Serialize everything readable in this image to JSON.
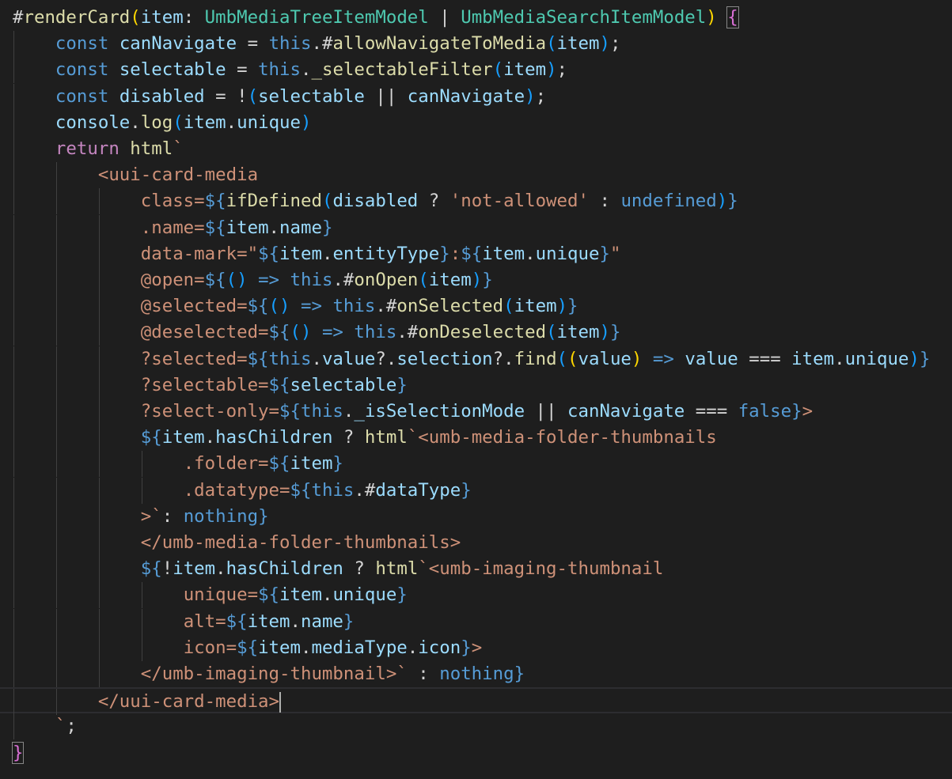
{
  "editor": {
    "cursor_line": 27,
    "lines": [
      {
        "n": 1,
        "indent": 0,
        "tokens": [
          [
            "d",
            "#"
          ],
          [
            "fn",
            "renderCard"
          ],
          [
            "b1",
            "("
          ],
          [
            "var",
            "item"
          ],
          [
            "d",
            ": "
          ],
          [
            "ty",
            "UmbMediaTreeItemModel"
          ],
          [
            "d",
            " | "
          ],
          [
            "ty",
            "UmbMediaSearchItemModel"
          ],
          [
            "b1",
            ")"
          ],
          [
            "d",
            " "
          ],
          [
            "bm2",
            "{"
          ]
        ]
      },
      {
        "n": 2,
        "indent": 1,
        "tokens": [
          [
            "kw",
            "const"
          ],
          [
            "d",
            " "
          ],
          [
            "var",
            "canNavigate"
          ],
          [
            "d",
            " = "
          ],
          [
            "kw",
            "this"
          ],
          [
            "d",
            ".#"
          ],
          [
            "fn",
            "allowNavigateToMedia"
          ],
          [
            "b3",
            "("
          ],
          [
            "var",
            "item"
          ],
          [
            "b3",
            ")"
          ],
          [
            "d",
            ";"
          ]
        ]
      },
      {
        "n": 3,
        "indent": 1,
        "tokens": [
          [
            "kw",
            "const"
          ],
          [
            "d",
            " "
          ],
          [
            "var",
            "selectable"
          ],
          [
            "d",
            " = "
          ],
          [
            "kw",
            "this"
          ],
          [
            "d",
            "."
          ],
          [
            "fn",
            "_selectableFilter"
          ],
          [
            "b3",
            "("
          ],
          [
            "var",
            "item"
          ],
          [
            "b3",
            ")"
          ],
          [
            "d",
            ";"
          ]
        ]
      },
      {
        "n": 4,
        "indent": 1,
        "tokens": [
          [
            "kw",
            "const"
          ],
          [
            "d",
            " "
          ],
          [
            "var",
            "disabled"
          ],
          [
            "d",
            " = !"
          ],
          [
            "b3",
            "("
          ],
          [
            "var",
            "selectable"
          ],
          [
            "d",
            " || "
          ],
          [
            "var",
            "canNavigate"
          ],
          [
            "b3",
            ")"
          ],
          [
            "d",
            ";"
          ]
        ]
      },
      {
        "n": 5,
        "indent": 1,
        "tokens": [
          [
            "var",
            "console"
          ],
          [
            "d",
            "."
          ],
          [
            "fn",
            "log"
          ],
          [
            "b3",
            "("
          ],
          [
            "var",
            "item"
          ],
          [
            "d",
            "."
          ],
          [
            "var",
            "unique"
          ],
          [
            "b3",
            ")"
          ]
        ]
      },
      {
        "n": 6,
        "indent": 1,
        "tokens": [
          [
            "kw2",
            "return"
          ],
          [
            "d",
            " "
          ],
          [
            "fn",
            "html"
          ],
          [
            "tag",
            "`"
          ]
        ]
      },
      {
        "n": 7,
        "indent": 2,
        "tokens": [
          [
            "tag",
            "<uui-card-media"
          ]
        ]
      },
      {
        "n": 8,
        "indent": 3,
        "tokens": [
          [
            "tag",
            "class="
          ],
          [
            "kw",
            "${"
          ],
          [
            "fn",
            "ifDefined"
          ],
          [
            "b3",
            "("
          ],
          [
            "var",
            "disabled"
          ],
          [
            "d",
            " ? "
          ],
          [
            "str",
            "'not-allowed'"
          ],
          [
            "d",
            " : "
          ],
          [
            "kw",
            "undefined"
          ],
          [
            "b3",
            ")"
          ],
          [
            "kw",
            "}"
          ]
        ]
      },
      {
        "n": 9,
        "indent": 3,
        "tokens": [
          [
            "tag",
            ".name="
          ],
          [
            "kw",
            "${"
          ],
          [
            "var",
            "item"
          ],
          [
            "d",
            "."
          ],
          [
            "var",
            "name"
          ],
          [
            "kw",
            "}"
          ]
        ]
      },
      {
        "n": 10,
        "indent": 3,
        "tokens": [
          [
            "tag",
            "data-mark=\""
          ],
          [
            "kw",
            "${"
          ],
          [
            "var",
            "item"
          ],
          [
            "d",
            "."
          ],
          [
            "var",
            "entityType"
          ],
          [
            "kw",
            "}"
          ],
          [
            "tag",
            ":"
          ],
          [
            "kw",
            "${"
          ],
          [
            "var",
            "item"
          ],
          [
            "d",
            "."
          ],
          [
            "var",
            "unique"
          ],
          [
            "kw",
            "}"
          ],
          [
            "tag",
            "\""
          ]
        ]
      },
      {
        "n": 11,
        "indent": 3,
        "tokens": [
          [
            "tag",
            "@open="
          ],
          [
            "kw",
            "${"
          ],
          [
            "b3",
            "()"
          ],
          [
            "d",
            " "
          ],
          [
            "kw",
            "=>"
          ],
          [
            "d",
            " "
          ],
          [
            "kw",
            "this"
          ],
          [
            "d",
            ".#"
          ],
          [
            "fn",
            "onOpen"
          ],
          [
            "b3",
            "("
          ],
          [
            "var",
            "item"
          ],
          [
            "b3",
            ")"
          ],
          [
            "kw",
            "}"
          ]
        ]
      },
      {
        "n": 12,
        "indent": 3,
        "tokens": [
          [
            "tag",
            "@selected="
          ],
          [
            "kw",
            "${"
          ],
          [
            "b3",
            "()"
          ],
          [
            "d",
            " "
          ],
          [
            "kw",
            "=>"
          ],
          [
            "d",
            " "
          ],
          [
            "kw",
            "this"
          ],
          [
            "d",
            ".#"
          ],
          [
            "fn",
            "onSelected"
          ],
          [
            "b3",
            "("
          ],
          [
            "var",
            "item"
          ],
          [
            "b3",
            ")"
          ],
          [
            "kw",
            "}"
          ]
        ]
      },
      {
        "n": 13,
        "indent": 3,
        "tokens": [
          [
            "tag",
            "@deselected="
          ],
          [
            "kw",
            "${"
          ],
          [
            "b3",
            "()"
          ],
          [
            "d",
            " "
          ],
          [
            "kw",
            "=>"
          ],
          [
            "d",
            " "
          ],
          [
            "kw",
            "this"
          ],
          [
            "d",
            ".#"
          ],
          [
            "fn",
            "onDeselected"
          ],
          [
            "b3",
            "("
          ],
          [
            "var",
            "item"
          ],
          [
            "b3",
            ")"
          ],
          [
            "kw",
            "}"
          ]
        ]
      },
      {
        "n": 14,
        "indent": 3,
        "tokens": [
          [
            "tag",
            "?selected="
          ],
          [
            "kw",
            "${"
          ],
          [
            "kw",
            "this"
          ],
          [
            "d",
            "."
          ],
          [
            "var",
            "value"
          ],
          [
            "d",
            "?."
          ],
          [
            "var",
            "selection"
          ],
          [
            "d",
            "?."
          ],
          [
            "fn",
            "find"
          ],
          [
            "b3",
            "("
          ],
          [
            "b1",
            "("
          ],
          [
            "var",
            "value"
          ],
          [
            "b1",
            ")"
          ],
          [
            "d",
            " "
          ],
          [
            "kw",
            "=>"
          ],
          [
            "d",
            " "
          ],
          [
            "var",
            "value"
          ],
          [
            "d",
            " === "
          ],
          [
            "var",
            "item"
          ],
          [
            "d",
            "."
          ],
          [
            "var",
            "unique"
          ],
          [
            "b3",
            ")"
          ],
          [
            "kw",
            "}"
          ]
        ]
      },
      {
        "n": 15,
        "indent": 3,
        "tokens": [
          [
            "tag",
            "?selectable="
          ],
          [
            "kw",
            "${"
          ],
          [
            "var",
            "selectable"
          ],
          [
            "kw",
            "}"
          ]
        ]
      },
      {
        "n": 16,
        "indent": 3,
        "tokens": [
          [
            "tag",
            "?select-only="
          ],
          [
            "kw",
            "${"
          ],
          [
            "kw",
            "this"
          ],
          [
            "d",
            "."
          ],
          [
            "var",
            "_isSelectionMode"
          ],
          [
            "d",
            " || "
          ],
          [
            "var",
            "canNavigate"
          ],
          [
            "d",
            " === "
          ],
          [
            "kw",
            "false"
          ],
          [
            "kw",
            "}"
          ],
          [
            "tag",
            ">"
          ]
        ]
      },
      {
        "n": 17,
        "indent": 3,
        "tokens": [
          [
            "kw",
            "${"
          ],
          [
            "var",
            "item"
          ],
          [
            "d",
            "."
          ],
          [
            "var",
            "hasChildren"
          ],
          [
            "d",
            " ? "
          ],
          [
            "fn",
            "html"
          ],
          [
            "tag",
            "`<umb-media-folder-thumbnails"
          ]
        ]
      },
      {
        "n": 18,
        "indent": 4,
        "tokens": [
          [
            "tag",
            ".folder="
          ],
          [
            "kw",
            "${"
          ],
          [
            "var",
            "item"
          ],
          [
            "kw",
            "}"
          ]
        ]
      },
      {
        "n": 19,
        "indent": 4,
        "tokens": [
          [
            "tag",
            ".datatype="
          ],
          [
            "kw",
            "${"
          ],
          [
            "kw",
            "this"
          ],
          [
            "d",
            ".#"
          ],
          [
            "var",
            "dataType"
          ],
          [
            "kw",
            "}"
          ]
        ]
      },
      {
        "n": 20,
        "indent": 3,
        "tokens": [
          [
            "tag",
            ">`"
          ],
          [
            "d",
            ": "
          ],
          [
            "kw",
            "nothing"
          ],
          [
            "kw",
            "}"
          ]
        ]
      },
      {
        "n": 21,
        "indent": 3,
        "tokens": [
          [
            "tag",
            "</umb-media-folder-thumbnails>"
          ]
        ]
      },
      {
        "n": 22,
        "indent": 3,
        "tokens": [
          [
            "kw",
            "${"
          ],
          [
            "d",
            "!"
          ],
          [
            "var",
            "item"
          ],
          [
            "d",
            "."
          ],
          [
            "var",
            "hasChildren"
          ],
          [
            "d",
            " ? "
          ],
          [
            "fn",
            "html"
          ],
          [
            "tag",
            "`<umb-imaging-thumbnail"
          ]
        ]
      },
      {
        "n": 23,
        "indent": 4,
        "tokens": [
          [
            "tag",
            "unique="
          ],
          [
            "kw",
            "${"
          ],
          [
            "var",
            "item"
          ],
          [
            "d",
            "."
          ],
          [
            "var",
            "unique"
          ],
          [
            "kw",
            "}"
          ]
        ]
      },
      {
        "n": 24,
        "indent": 4,
        "tokens": [
          [
            "tag",
            "alt="
          ],
          [
            "kw",
            "${"
          ],
          [
            "var",
            "item"
          ],
          [
            "d",
            "."
          ],
          [
            "var",
            "name"
          ],
          [
            "kw",
            "}"
          ]
        ]
      },
      {
        "n": 25,
        "indent": 4,
        "tokens": [
          [
            "tag",
            "icon="
          ],
          [
            "kw",
            "${"
          ],
          [
            "var",
            "item"
          ],
          [
            "d",
            "."
          ],
          [
            "var",
            "mediaType"
          ],
          [
            "d",
            "."
          ],
          [
            "var",
            "icon"
          ],
          [
            "kw",
            "}"
          ],
          [
            "tag",
            ">"
          ]
        ]
      },
      {
        "n": 26,
        "indent": 3,
        "tokens": [
          [
            "tag",
            "</umb-imaging-thumbnail>`"
          ],
          [
            "d",
            " : "
          ],
          [
            "kw",
            "nothing"
          ],
          [
            "kw",
            "}"
          ]
        ]
      },
      {
        "n": 27,
        "indent": 2,
        "tokens": [
          [
            "tag",
            "</uui-card-media>"
          ]
        ]
      },
      {
        "n": 28,
        "indent": 1,
        "tokens": [
          [
            "tag",
            "`"
          ],
          [
            "d",
            ";"
          ]
        ]
      },
      {
        "n": 29,
        "indent": 0,
        "tokens": [
          [
            "bm2",
            "}"
          ]
        ]
      }
    ]
  }
}
